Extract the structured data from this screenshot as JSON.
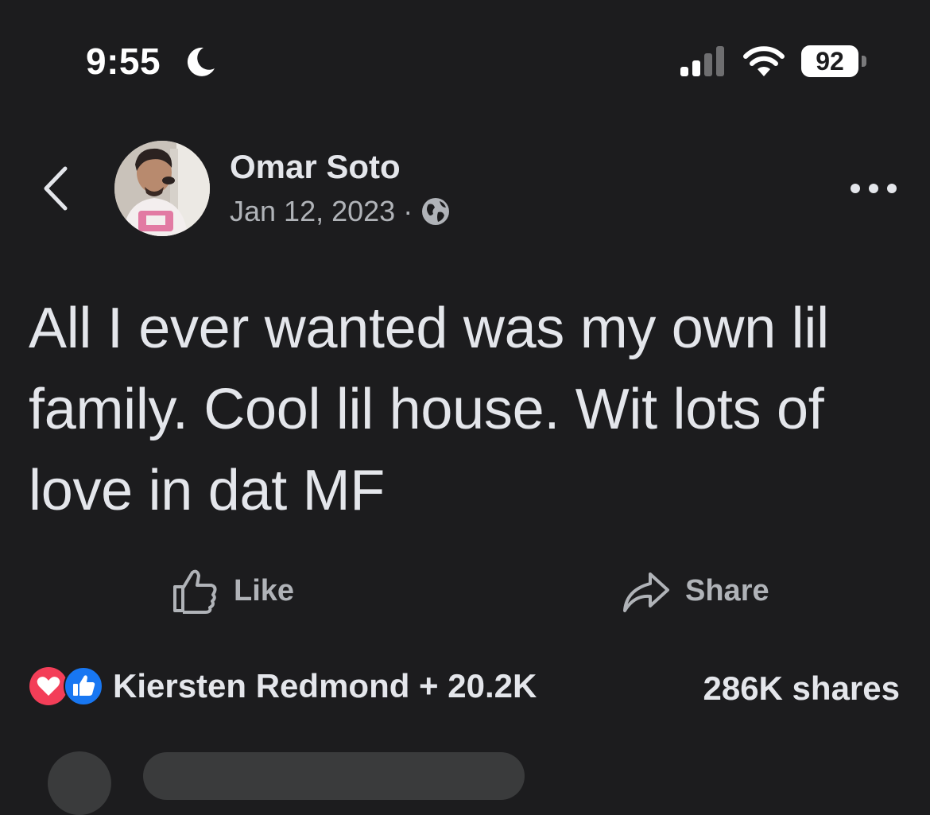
{
  "status_bar": {
    "time": "9:55",
    "battery": "92",
    "icons": [
      "moon-icon",
      "signal-icon",
      "wifi-icon",
      "battery-icon"
    ]
  },
  "post": {
    "author": "Omar Soto",
    "date": "Jan 12, 2023",
    "separator": "·",
    "privacy_icon": "globe-icon",
    "text": "All I ever wanted was my own lil family. Cool lil house. Wit lots of love in dat MF"
  },
  "actions": {
    "like_label": "Like",
    "share_label": "Share"
  },
  "engagement": {
    "reaction_summary": "Kiersten Redmond + 20.2K",
    "shares": "286K shares",
    "reaction_icons": [
      "love-reaction-icon",
      "like-reaction-icon"
    ]
  },
  "colors": {
    "background": "#1c1c1e",
    "text_primary": "#e4e6eb",
    "text_secondary": "#b0b3b8",
    "love": "#f33e58",
    "like": "#1877f2"
  }
}
